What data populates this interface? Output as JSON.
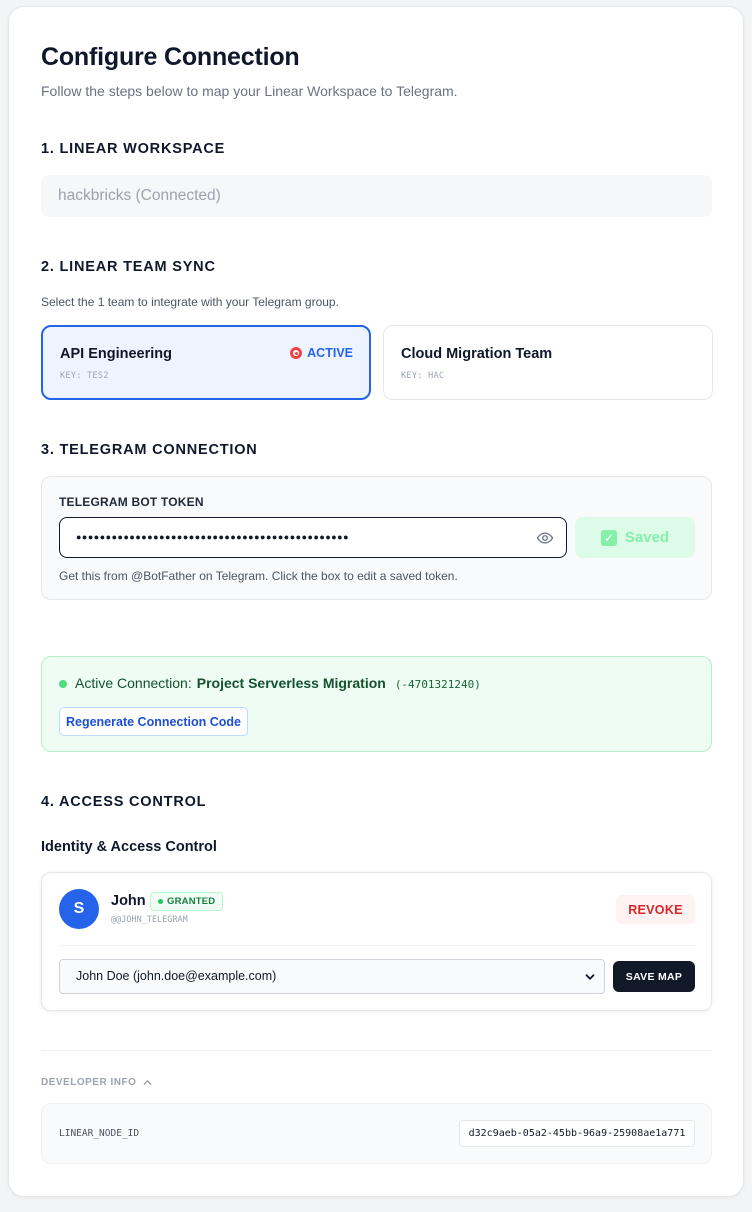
{
  "header": {
    "title": "Configure Connection",
    "subtitle": "Follow the steps below to map your Linear Workspace to Telegram."
  },
  "workspace": {
    "heading": "1. LINEAR WORKSPACE",
    "value": "hackbricks (Connected)"
  },
  "team_sync": {
    "heading": "2. LINEAR TEAM SYNC",
    "help": "Select the 1 team to integrate with your Telegram group.",
    "teams": [
      {
        "name": "API Engineering",
        "key": "KEY: TES2",
        "status": "ACTIVE",
        "selected": true
      },
      {
        "name": "Cloud Migration Team",
        "key": "KEY: HAC",
        "status": "",
        "selected": false
      }
    ]
  },
  "telegram": {
    "heading": "3. TELEGRAM CONNECTION",
    "token_label": "TELEGRAM BOT TOKEN",
    "token_value": "●●●●●●●●●●●●●●●●●●●●●●●●●●●●●●●●●●●●●●●●●●●●●●",
    "saved_label": "Saved",
    "help": "Get this from @BotFather on Telegram. Click the box to edit a saved token."
  },
  "connection": {
    "label": "Active Connection:",
    "name": "Project Serverless Migration",
    "chat_id": "(-4701321240)",
    "regenerate_label": "Regenerate Connection Code",
    "status_color": "#4ade80"
  },
  "access": {
    "heading": "4. ACCESS CONTROL",
    "subheading": "Identity & Access Control",
    "user": {
      "avatar_letter": "S",
      "name": "John",
      "badge": "GRANTED",
      "handle": "@@JOHN_TELEGRAM",
      "revoke_label": "REVOKE",
      "mapped_to": "John Doe (john.doe@example.com)",
      "save_map_label": "SAVE MAP"
    }
  },
  "developer": {
    "toggle_label": "DEVELOPER INFO",
    "node_label": "LINEAR_NODE_ID",
    "node_value": "d32c9aeb-05a2-45bb-96a9-25908ae1a771"
  },
  "colors": {
    "accent": "#2563eb",
    "success": "#22c55e",
    "danger": "#dc2626",
    "dark": "#111827"
  }
}
